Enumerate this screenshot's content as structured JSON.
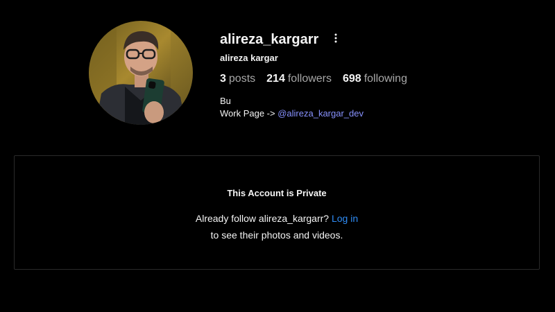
{
  "profile": {
    "username": "alireza_kargarr",
    "full_name": "alireza kargar",
    "stats": {
      "posts_count": "3",
      "posts_label": "posts",
      "followers_count": "214",
      "followers_label": "followers",
      "following_count": "698",
      "following_label": "following"
    },
    "bio": {
      "line1": "Bu",
      "line2_prefix": "Work Page -> ",
      "line2_link": "@alireza_kargar_dev"
    },
    "more_icon": "more-vertical-icon"
  },
  "private_notice": {
    "title": "This Account is Private",
    "line1_prefix": "Already follow alireza_kargarr? ",
    "login_link": "Log in",
    "line2": "to see their photos and videos."
  },
  "colors": {
    "background": "#000000",
    "text": "#f5f5f5",
    "muted": "#a8a8a8",
    "link": "#2f8cf5",
    "bio_link": "#8892ff",
    "border": "#2a2a2a"
  }
}
